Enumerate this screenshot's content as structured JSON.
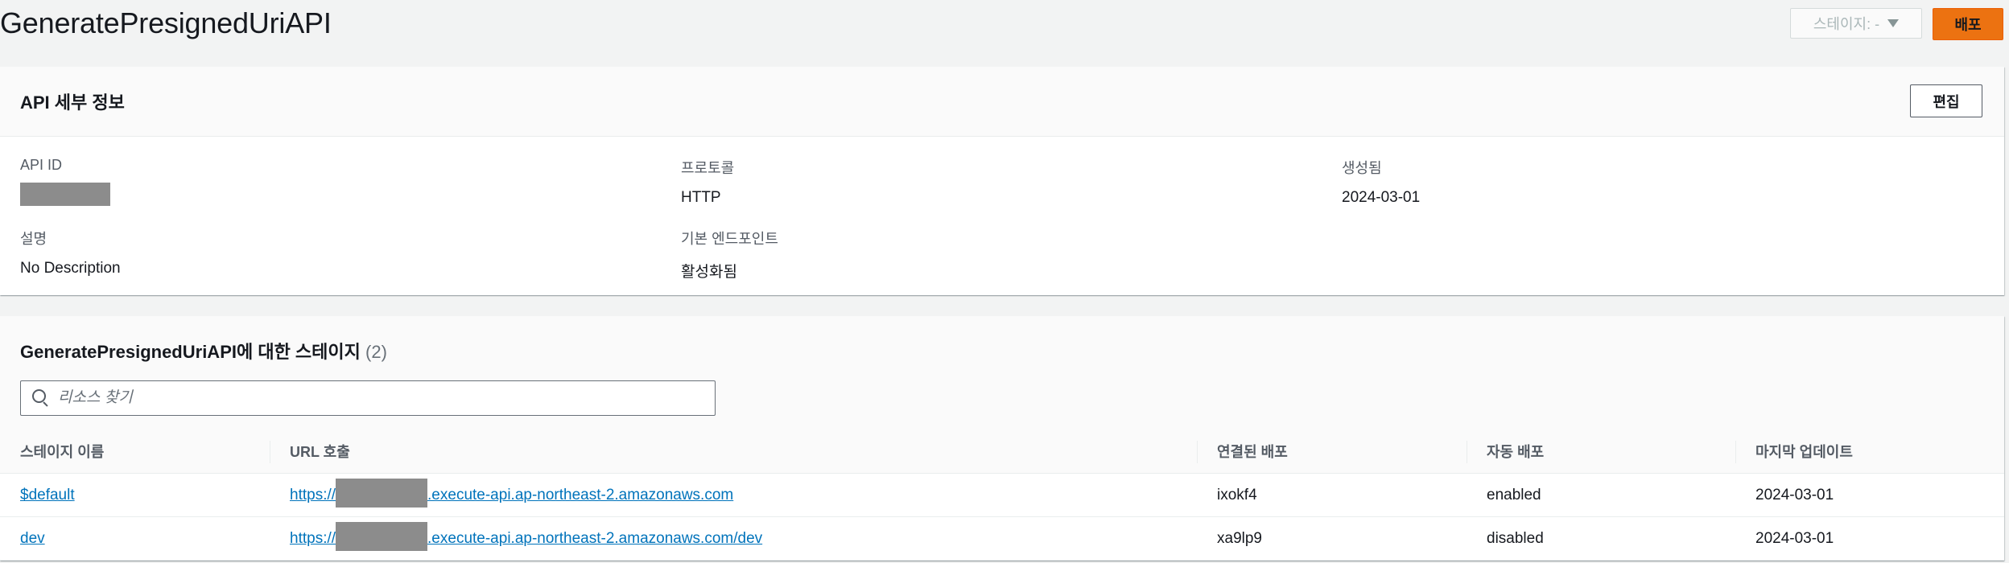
{
  "header": {
    "title": "GeneratePresignedUriAPI",
    "stage_selector": "스테이지: -",
    "deploy_label": "배포"
  },
  "details": {
    "heading": "API 세부 정보",
    "edit_label": "편집",
    "fields": {
      "api_id": {
        "label": "API ID",
        "value": ""
      },
      "protocol": {
        "label": "프로토콜",
        "value": "HTTP"
      },
      "created": {
        "label": "생성됨",
        "value": "2024-03-01"
      },
      "description": {
        "label": "설명",
        "value": "No Description"
      },
      "default_endpoint": {
        "label": "기본 엔드포인트",
        "value": "활성화됨"
      }
    }
  },
  "stages": {
    "heading": "GeneratePresignedUriAPI에 대한 스테이지",
    "count": "(2)",
    "search_placeholder": "리소스 찾기",
    "columns": [
      "스테이지 이름",
      "URL 호출",
      "연결된 배포",
      "자동 배포",
      "마지막 업데이트"
    ],
    "rows": [
      {
        "name": "$default",
        "url_prefix": "https://",
        "url_suffix": ".execute-api.ap-northeast-2.amazonaws.com",
        "deployment": "ixokf4",
        "auto_deploy": "enabled",
        "updated": "2024-03-01"
      },
      {
        "name": "dev",
        "url_prefix": "https://",
        "url_suffix": ".execute-api.ap-northeast-2.amazonaws.com/dev",
        "deployment": "xa9lp9",
        "auto_deploy": "disabled",
        "updated": "2024-03-01"
      }
    ]
  },
  "colors": {
    "accent": "#ec7211",
    "link": "#0073bb",
    "background": "#f2f3f3",
    "redaction": "#8c8c8c"
  },
  "icons": {
    "stage_dropdown": "caret-down-icon",
    "search": "search-icon"
  }
}
